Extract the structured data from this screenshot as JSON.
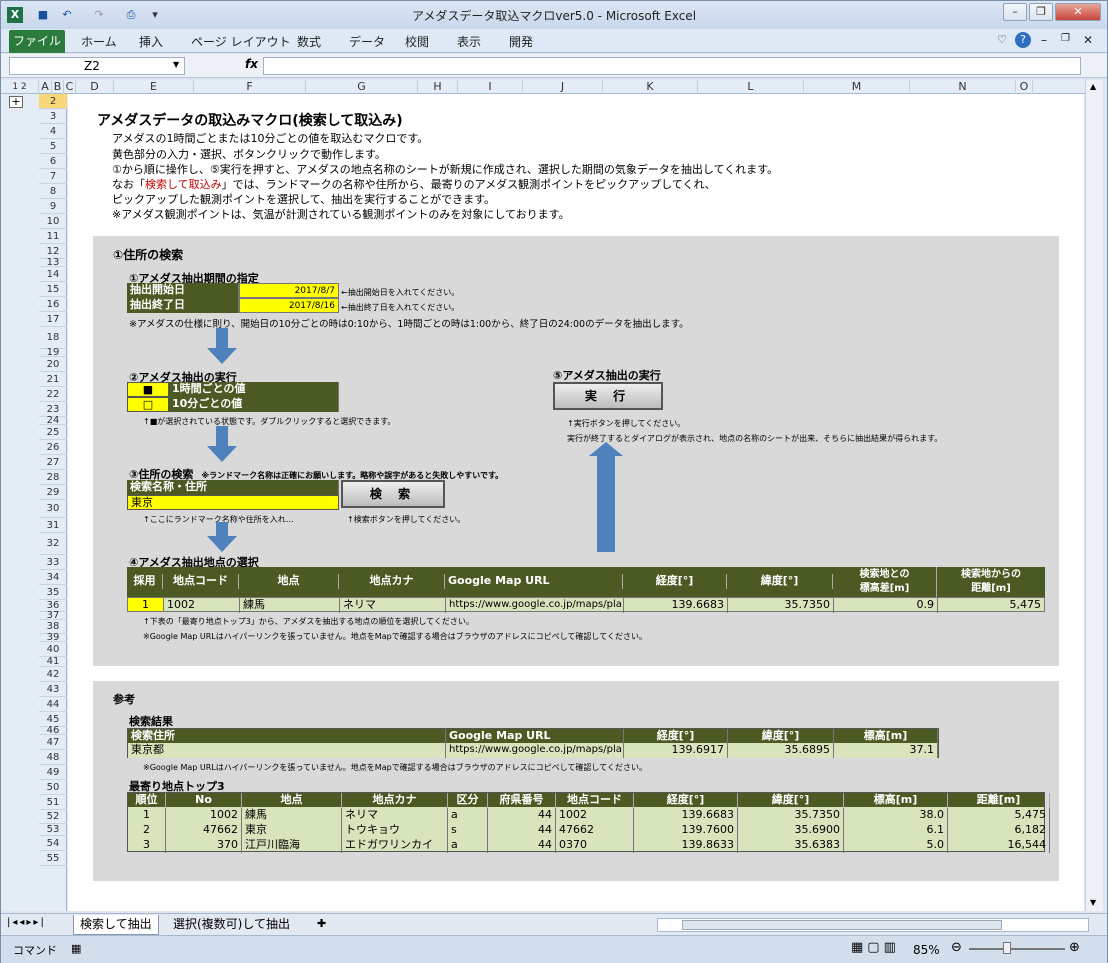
{
  "window": {
    "title": "アメダスデータ取込マクロver5.0  -  Microsoft Excel"
  },
  "ribbon": {
    "tabs": [
      "ファイル",
      "ホーム",
      "挿入",
      "ページ レイアウト",
      "数式",
      "データ",
      "校閲",
      "表示",
      "開発"
    ]
  },
  "namebox": "Z2",
  "fx": "fx",
  "columns": [
    "A",
    "B",
    "C",
    "D",
    "E",
    "F",
    "G",
    "H",
    "I",
    "J",
    "K",
    "L",
    "M",
    "N",
    "O"
  ],
  "rows": [
    "2",
    "3",
    "4",
    "5",
    "6",
    "7",
    "8",
    "9",
    "10",
    "11",
    "12",
    "13",
    "14",
    "15",
    "16",
    "17",
    "18",
    "19",
    "20",
    "21",
    "22",
    "23",
    "24",
    "25",
    "26",
    "27",
    "28",
    "29",
    "30",
    "31",
    "32",
    "33",
    "34",
    "35",
    "36",
    "37",
    "38",
    "39",
    "40",
    "41",
    "42",
    "43",
    "44",
    "45",
    "46",
    "47",
    "48",
    "49",
    "50",
    "51",
    "52",
    "53",
    "54",
    "55"
  ],
  "intro": {
    "heading": "アメダスデータの取込みマクロ(検索して取込み)",
    "lines": [
      "アメダスの1時間ごとまたは10分ごとの値を取込むマクロです。",
      "黄色部分の入力・選択、ボタンクリックで動作します。",
      "①から順に操作し、⑤実行を押すと、アメダスの地点名称のシートが新規に作成され、選択した期間の気象データを抽出してくれます。",
      "ピックアップした観測ポイントを選択して、抽出を実行することができます。",
      "※アメダス観測ポイントは、気温が計測されている観測ポイントのみを対象にしております。"
    ],
    "line7a": "なお「",
    "line7red": "検索して取込み",
    "line7b": "」では、ランドマークの名称や住所から、最寄りのアメダス観測ポイントをピックアップしてくれ、"
  },
  "s1": {
    "title": "①住所の検索",
    "period_title": "①アメダス抽出期間の指定",
    "start_label": "抽出開始日",
    "start_value": "2017/8/7",
    "start_note": "←抽出開始日を入れてください。",
    "end_label": "抽出終了日",
    "end_value": "2017/8/16",
    "end_note": "←抽出終了日を入れてください。",
    "period_note": "※アメダスの仕様に則り、開始日の10分ごとの時は0:10から、1時間ごとの時は1:00から、終了日の24:00のデータを抽出します。",
    "exec_title": "②アメダス抽出の実行",
    "opt1_mark": "■",
    "opt1": "1時間ごとの値",
    "opt2_mark": "□",
    "opt2": "10分ごとの値",
    "opt_note": "↑■が選択されている状態です。ダブルクリックすると選択できます。",
    "search_title": "③住所の検索",
    "search_hint": "※ランドマーク名称は正確にお願いします。略称や誤字があると失敗しやすいです。",
    "search_label": "検索名称・住所",
    "search_value": "東京",
    "search_button": "検 索",
    "search_note1": "↑ここにランドマーク名称や住所を入れ…",
    "search_note2": "↑検索ボタンを押してください。",
    "run_title": "⑤アメダス抽出の実行",
    "run_button": "実 行",
    "run_note1": "↑実行ボタンを押してください。",
    "run_note2": "実行が終了するとダイアログが表示され、地点の名称のシートが出来、そちらに抽出結果が得られます。",
    "select_title": "④アメダス抽出地点の選択",
    "sel_headers": [
      "採用",
      "地点コード",
      "地点",
      "地点カナ",
      "Google Map URL",
      "経度[°]",
      "緯度[°]",
      "検索地との\n標高差[m]",
      "検索地からの\n距離[m]"
    ],
    "sel_row": [
      "1",
      "1002",
      "練馬",
      "ネリマ",
      "https://www.google.co.jp/maps/pla",
      "139.6683",
      "35.7350",
      "0.9",
      "5,475"
    ],
    "sel_note1": "↑下表の「最寄り地点トップ3」から、アメダスを抽出する地点の順位を選択してください。",
    "sel_note2": "※Google Map URLはハイパーリンクを張っていません。地点をMapで確認する場合はブラウザのアドレスにコピペして確認してください。"
  },
  "s2": {
    "title": "参考",
    "result_title": "検索結果",
    "res_headers": [
      "検索住所",
      "Google Map URL",
      "経度[°]",
      "緯度[°]",
      "標高[m]"
    ],
    "res_row": [
      "東京都",
      "https://www.google.co.jp/maps/pla",
      "139.6917",
      "35.6895",
      "37.1"
    ],
    "res_note": "※Google Map URLはハイパーリンクを張っていません。地点をMapで確認する場合はブラウザのアドレスにコピペして確認してください。",
    "top3_title": "最寄り地点トップ3",
    "top_headers": [
      "順位",
      "No",
      "地点",
      "地点カナ",
      "区分",
      "府県番号",
      "地点コード",
      "経度[°]",
      "緯度[°]",
      "標高[m]",
      "距離[m]"
    ],
    "top_rows": [
      [
        "1",
        "1002",
        "練馬",
        "ネリマ",
        "a",
        "44",
        "1002",
        "139.6683",
        "35.7350",
        "38.0",
        "5,475"
      ],
      [
        "2",
        "47662",
        "東京",
        "トウキョウ",
        "s",
        "44",
        "47662",
        "139.7600",
        "35.6900",
        "6.1",
        "6,182"
      ],
      [
        "3",
        "370",
        "江戸川臨海",
        "エドガワリンカイ",
        "a",
        "44",
        "0370",
        "139.8633",
        "35.6383",
        "5.0",
        "16,544"
      ]
    ]
  },
  "sheets": [
    "検索して抽出",
    "選択(複数可)して抽出"
  ],
  "status": {
    "mode": "コマンド",
    "zoom": "85%"
  },
  "colors": {
    "header_dark": "#4b5a23",
    "row_light": "#d8e4bc",
    "input": "#ffff00",
    "arrow": "#4f81bd",
    "excel_green": "#2a7b3c"
  }
}
